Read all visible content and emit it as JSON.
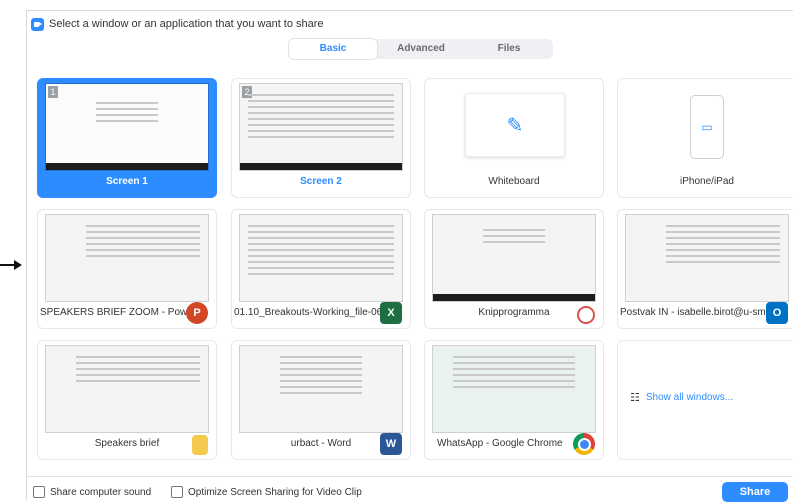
{
  "window": {
    "title": "Select a window or an application that you want to share"
  },
  "tabs": [
    {
      "label": "Basic",
      "active": true
    },
    {
      "label": "Advanced",
      "active": false
    },
    {
      "label": "Files",
      "active": false
    }
  ],
  "cards": [
    {
      "label": "Screen 1",
      "screen_number": "1",
      "selected": true
    },
    {
      "label": "Screen 2",
      "screen_number": "2",
      "selected": false
    },
    {
      "label": "Whiteboard"
    },
    {
      "label": "iPhone/iPad"
    },
    {
      "label": "SPEAKERS BRIEF ZOOM - PowerP...",
      "app_icon": "powerpoint-icon"
    },
    {
      "label": "01.10_Breakouts-Working_file-06_...",
      "app_icon": "excel-icon"
    },
    {
      "label": "Knipprogramma",
      "app_icon": "snipping-tool-icon"
    },
    {
      "label": "Postvak IN - isabelle.birot@u-sm...",
      "app_icon": "outlook-icon"
    },
    {
      "label": "Speakers brief",
      "app_icon": "folder-icon"
    },
    {
      "label": "urbact - Word",
      "app_icon": "word-icon"
    },
    {
      "label": "WhatsApp - Google Chrome",
      "app_icon": "chrome-icon"
    },
    {
      "label": "Show all windows..."
    }
  ],
  "footer": {
    "share_sound": "Share computer sound",
    "optimize_video": "Optimize Screen Sharing for Video Clip",
    "share_button": "Share"
  },
  "colors": {
    "accent": "#2d8cff"
  }
}
